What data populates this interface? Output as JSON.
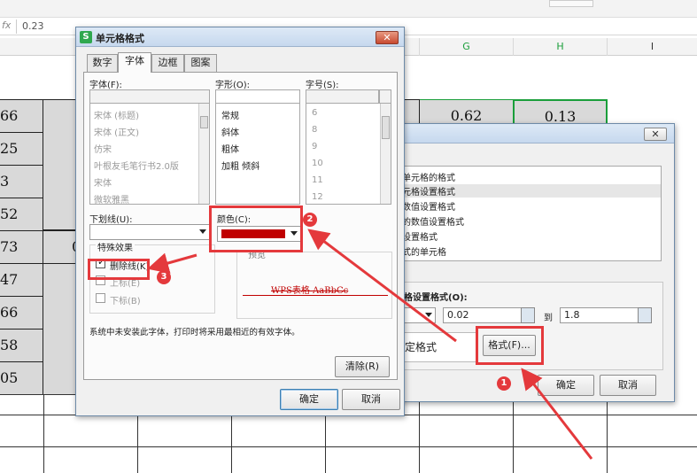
{
  "formula_bar": {
    "fx": "fx",
    "value": "0.23"
  },
  "columns": [
    "G",
    "H",
    "I"
  ],
  "row_values": [
    "66",
    "25",
    "3",
    "52",
    "73",
    "47",
    "66",
    "58",
    "05"
  ],
  "row5_extra": "0",
  "cells_top": [
    "0.62",
    "0.13"
  ],
  "format_dialog": {
    "title": "单元格格式",
    "tabs": [
      "数字",
      "字体",
      "边框",
      "图案"
    ],
    "active_tab": "字体",
    "font_label": "字体(F):",
    "style_label": "字形(O):",
    "size_label": "字号(S):",
    "fonts": [
      "宋体 (标题)",
      "宋体 (正文)",
      "仿宋",
      "叶根友毛笔行书2.0版",
      "宋体",
      "微软雅黑"
    ],
    "styles": [
      "常规",
      "斜体",
      "粗体",
      "加粗 倾斜"
    ],
    "sizes": [
      "6",
      "8",
      "9",
      "10",
      "11",
      "12"
    ],
    "underline_label": "下划线(U):",
    "color_label": "颜色(C):",
    "color_value": "#c00000",
    "effects_label": "特殊效果",
    "strike_label": "删除线(K)",
    "super_label": "上标(E)",
    "sub_label": "下标(B)",
    "preview_label": "预览",
    "preview_text": "WPS表格  AaBbCc",
    "note": "系统中未安装此字体，打印时将采用最相近的有效字体。",
    "clear_btn": "清除(R)",
    "ok_btn": "确定",
    "cancel_btn": "取消"
  },
  "cf_dialog": {
    "close_glyph": "✕",
    "rules": [
      "单元格的格式",
      "元格设置格式",
      "数值设置格式",
      "的数值设置格式",
      "设置格式",
      "式的单元格"
    ],
    "edit_label": "格设置格式(O):",
    "from_value": "0.02",
    "to_label": "到",
    "to_value": "1.8",
    "preview_text": "定格式",
    "format_btn": "格式(F)...",
    "ok_btn": "确定",
    "cancel_btn": "取消"
  },
  "badges": [
    "1",
    "2",
    "3"
  ],
  "accent_red": "#e4393c"
}
